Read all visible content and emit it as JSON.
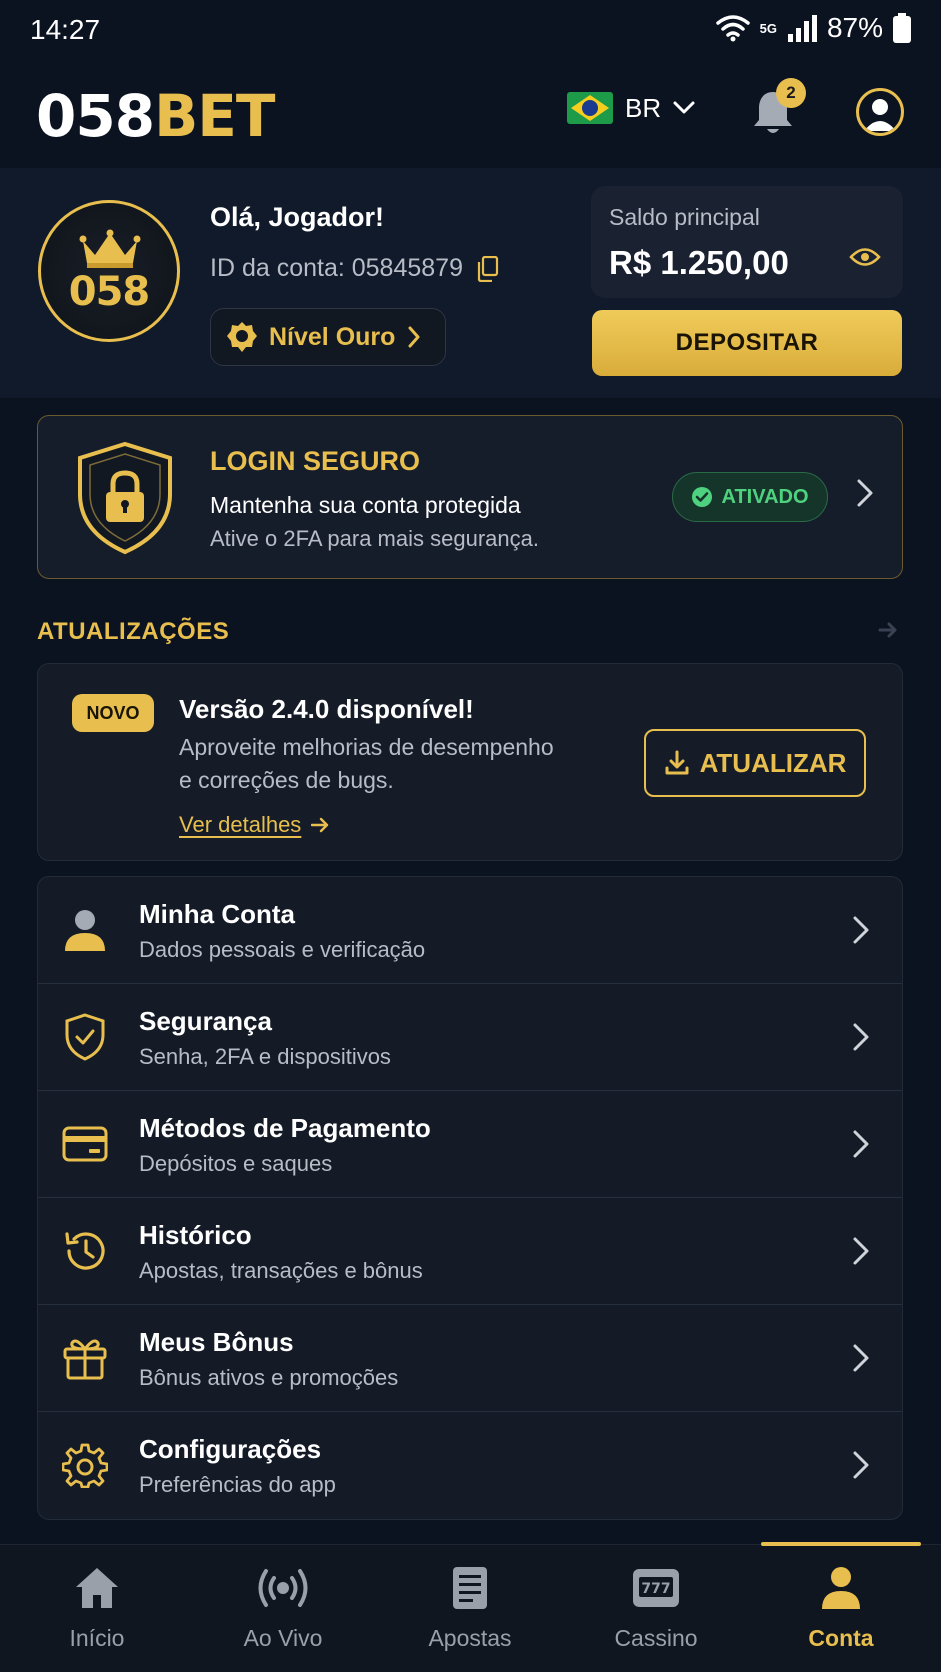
{
  "status_bar": {
    "time": "14:27",
    "network": "5G",
    "battery": "87%"
  },
  "header": {
    "logo_white": "058",
    "logo_gold": "BET",
    "language": "BR",
    "notifications_count": "2"
  },
  "profile": {
    "crest_text": "058",
    "greeting": "Olá, Jogador!",
    "account_id": "ID da conta: 05845879",
    "level": "Nível Ouro",
    "balance_label": "Saldo principal",
    "balance_value": "R$ 1.250,00",
    "deposit_label": "DEPOSITAR"
  },
  "secure_login": {
    "title": "LOGIN SEGURO",
    "subtitle": "Mantenha sua conta protegida",
    "description": "Ative o 2FA para mais segurança.",
    "status": "ATIVADO"
  },
  "updates": {
    "heading": "ATUALIZAÇÕES",
    "badge": "NOVO",
    "title": "Versão 2.4.0 disponível!",
    "desc_line1": "Aproveite melhorias de desempenho",
    "desc_line2": "e correções de bugs.",
    "details_link": "Ver detalhes",
    "update_button": "ATUALIZAR"
  },
  "menu": {
    "items": [
      {
        "icon": "user-icon",
        "title": "Minha Conta",
        "subtitle": "Dados pessoais e verificação"
      },
      {
        "icon": "shield-check-icon",
        "title": "Segurança",
        "subtitle": "Senha, 2FA e dispositivos"
      },
      {
        "icon": "credit-card-icon",
        "title": "Métodos de Pagamento",
        "subtitle": "Depósitos e saques"
      },
      {
        "icon": "history-icon",
        "title": "Histórico",
        "subtitle": "Apostas, transações e bônus"
      },
      {
        "icon": "gift-icon",
        "title": "Meus Bônus",
        "subtitle": "Bônus ativos e promoções"
      },
      {
        "icon": "gear-icon",
        "title": "Configurações",
        "subtitle": "Preferências do app"
      }
    ]
  },
  "bottom_nav": {
    "items": [
      {
        "icon": "home-icon",
        "label": "Início"
      },
      {
        "icon": "live-broadcast-icon",
        "label": "Ao Vivo"
      },
      {
        "icon": "betslip-icon",
        "label": "Apostas"
      },
      {
        "icon": "slot-machine-icon",
        "label": "Cassino"
      },
      {
        "icon": "user-icon",
        "label": "Conta"
      }
    ],
    "active": "Conta"
  },
  "colors": {
    "background": "#0b1220",
    "accent_gold": "#e8bf4e",
    "success_green": "#4ed27f"
  }
}
